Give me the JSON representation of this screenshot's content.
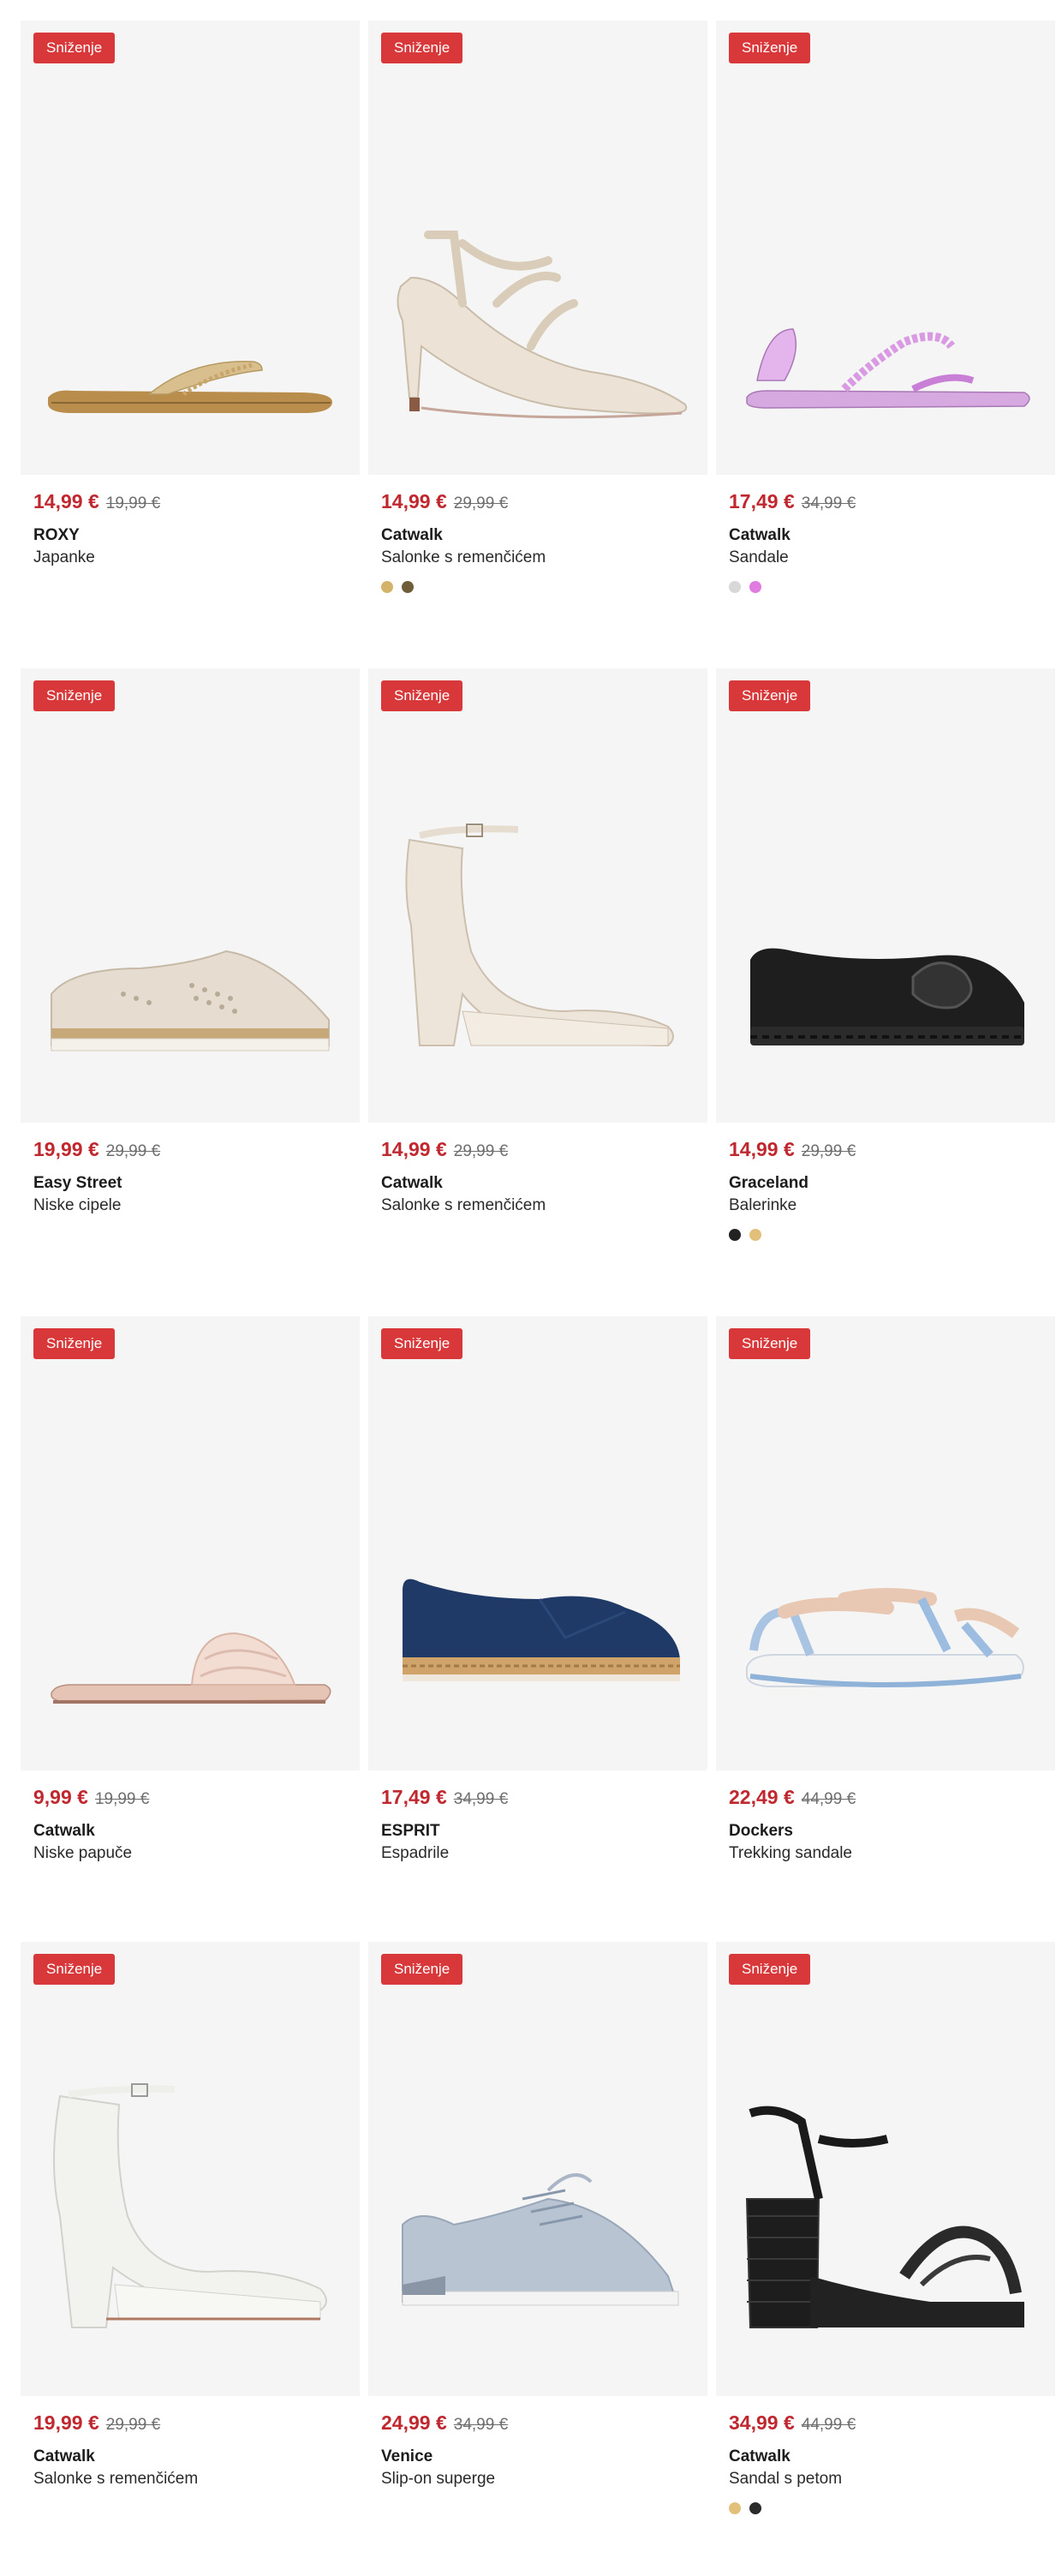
{
  "badge_label": "Sniženje",
  "products": [
    {
      "price_now": "14,99 €",
      "price_old": "19,99 €",
      "brand": "ROXY",
      "name": "Japanke",
      "swatches": []
    },
    {
      "price_now": "14,99 €",
      "price_old": "29,99 €",
      "brand": "Catwalk",
      "name": "Salonke s remenčićem",
      "swatches": [
        "#d5b26a",
        "#6f5d3a"
      ]
    },
    {
      "price_now": "17,49 €",
      "price_old": "34,99 €",
      "brand": "Catwalk",
      "name": "Sandale",
      "swatches": [
        "#d8d8d8",
        "#e07be0"
      ]
    },
    {
      "price_now": "19,99 €",
      "price_old": "29,99 €",
      "brand": "Easy Street",
      "name": "Niske cipele",
      "swatches": []
    },
    {
      "price_now": "14,99 €",
      "price_old": "29,99 €",
      "brand": "Catwalk",
      "name": "Salonke s remenčićem",
      "swatches": []
    },
    {
      "price_now": "14,99 €",
      "price_old": "29,99 €",
      "brand": "Graceland",
      "name": "Balerinke",
      "swatches": [
        "#222222",
        "#e3c07a"
      ]
    },
    {
      "price_now": "9,99 €",
      "price_old": "19,99 €",
      "brand": "Catwalk",
      "name": "Niske papuče",
      "swatches": []
    },
    {
      "price_now": "17,49 €",
      "price_old": "34,99 €",
      "brand": "ESPRIT",
      "name": "Espadrile",
      "swatches": []
    },
    {
      "price_now": "22,49 €",
      "price_old": "44,99 €",
      "brand": "Dockers",
      "name": "Trekking sandale",
      "swatches": []
    },
    {
      "price_now": "19,99 €",
      "price_old": "29,99 €",
      "brand": "Catwalk",
      "name": "Salonke s remenčićem",
      "swatches": []
    },
    {
      "price_now": "24,99 €",
      "price_old": "34,99 €",
      "brand": "Venice",
      "name": "Slip-on superge",
      "swatches": []
    },
    {
      "price_now": "34,99 €",
      "price_old": "44,99 €",
      "brand": "Catwalk",
      "name": "Sandal s petom",
      "swatches": [
        "#e3c07a",
        "#2a2a2a"
      ]
    }
  ]
}
